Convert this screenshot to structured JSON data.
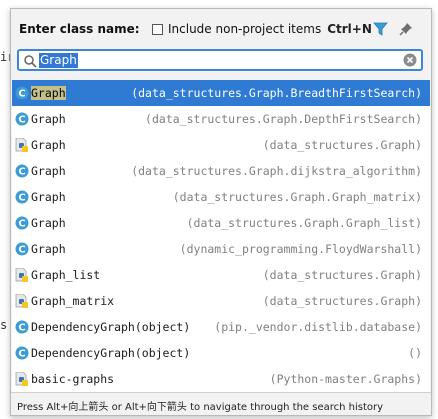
{
  "background": {
    "gutter_text_1": "ir",
    "gutter_text_2": "s"
  },
  "header": {
    "title": "Enter class name:",
    "include_label": "Include non-project items",
    "include_checked": false,
    "shortcut": "Ctrl+N",
    "filter_icon": "filter-icon",
    "pin_icon": "pin-icon"
  },
  "search": {
    "value": "Graph",
    "search_icon": "search-icon",
    "clear_icon": "clear-icon"
  },
  "results": [
    {
      "icon": "class-icon",
      "name": "Graph",
      "location": "(data_structures.Graph.BreadthFirstSearch)",
      "selected": true
    },
    {
      "icon": "class-icon",
      "name": "Graph",
      "location": "(data_structures.Graph.DepthFirstSearch)",
      "selected": false
    },
    {
      "icon": "python-file-icon",
      "name": "Graph",
      "location": "(data_structures.Graph)",
      "selected": false
    },
    {
      "icon": "class-icon",
      "name": "Graph",
      "location": "(data_structures.Graph.dijkstra_algorithm)",
      "selected": false
    },
    {
      "icon": "class-icon",
      "name": "Graph",
      "location": "(data_structures.Graph.Graph_matrix)",
      "selected": false
    },
    {
      "icon": "class-icon",
      "name": "Graph",
      "location": "(data_structures.Graph.Graph_list)",
      "selected": false
    },
    {
      "icon": "class-icon",
      "name": "Graph",
      "location": "(dynamic_programming.FloydWarshall)",
      "selected": false
    },
    {
      "icon": "python-file-icon",
      "name": "Graph_list",
      "location": "(data_structures.Graph)",
      "selected": false
    },
    {
      "icon": "python-file-icon",
      "name": "Graph_matrix",
      "location": "(data_structures.Graph)",
      "selected": false
    },
    {
      "icon": "class-icon",
      "name": "DependencyGraph(object)",
      "location": "(pip._vendor.distlib.database)",
      "selected": false
    },
    {
      "icon": "class-icon",
      "name": "DependencyGraph(object)",
      "location": "()",
      "selected": false
    },
    {
      "icon": "python-file-icon",
      "name": "basic-graphs",
      "location": "(Python-master.Graphs)",
      "selected": false
    }
  ],
  "footer": {
    "hint": "Press Alt+向上箭头 or Alt+向下箭头 to navigate through the search history"
  },
  "colors": {
    "selection": "#2f7ad3",
    "class_icon": "#3a9bd6",
    "accent_blue": "#3d86d6"
  }
}
